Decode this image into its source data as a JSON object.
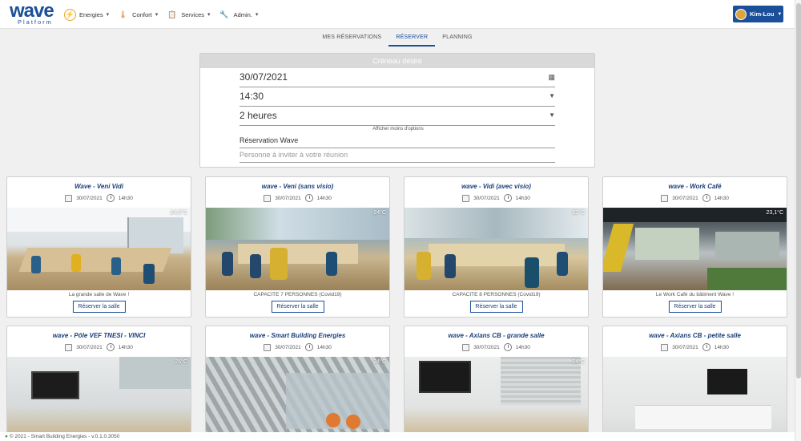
{
  "brand": {
    "name": "wave",
    "sub": "Platform"
  },
  "nav": [
    {
      "label": "Energies",
      "icon": "lightning-icon",
      "color": "#f0a020"
    },
    {
      "label": "Confort",
      "icon": "thermometer-icon",
      "color": "#e07a30"
    },
    {
      "label": "Services",
      "icon": "clipboard-icon",
      "color": "#5a7fbf"
    },
    {
      "label": "Admin.",
      "icon": "tools-icon",
      "color": "#c08050"
    }
  ],
  "user": {
    "name": "Kim-Lou"
  },
  "tabs": [
    {
      "label": "MES RÉSERVATIONS",
      "active": false
    },
    {
      "label": "RÉSERVER",
      "active": true
    },
    {
      "label": "PLANNING",
      "active": false
    }
  ],
  "form": {
    "title": "Créneau désiré",
    "date": "30/07/2021",
    "time": "14:30",
    "duration": "2 heures",
    "options_link": "Afficher moins d'options",
    "subject": "Réservation Wave",
    "invite_placeholder": "Personne à inviter à votre réunion"
  },
  "cards": [
    {
      "title": "Wave - Veni Vidi",
      "date": "30/07/2021",
      "time": "14h30",
      "temp": "24,5°C",
      "desc": "La grande salle de Wave !",
      "button": "Réserver la salle"
    },
    {
      "title": "wave - Veni (sans visio)",
      "date": "30/07/2021",
      "time": "14h30",
      "temp": "24°C",
      "desc": "CAPACITE 7 PERSONNES (Covid19)",
      "button": "Réserver la salle"
    },
    {
      "title": "wave - Vidi (avec visio)",
      "date": "30/07/2021",
      "time": "14h30",
      "temp": "23°C",
      "desc": "CAPACITE 8 PERSONNES (Covid19)",
      "button": "Réserver la salle"
    },
    {
      "title": "wave - Work Café",
      "date": "30/07/2021",
      "time": "14h30",
      "temp": "23,1°C",
      "desc": "Le Work Café du bâtiment Wave !",
      "button": "Réserver la salle"
    },
    {
      "title": "wave - Pôle VEF TNESI - VINCI",
      "date": "30/07/2021",
      "time": "14h30",
      "temp": "26°C",
      "desc": "",
      "button": ""
    },
    {
      "title": "wave - Smart Building Energies",
      "date": "30/07/2021",
      "time": "14h30",
      "temp": "24°C",
      "desc": "",
      "button": ""
    },
    {
      "title": "wave - Axians CB - grande salle",
      "date": "30/07/2021",
      "time": "14h30",
      "temp": "24°C",
      "desc": "",
      "button": ""
    },
    {
      "title": "wave - Axians CB - petite salle",
      "date": "30/07/2021",
      "time": "14h30",
      "temp": "",
      "desc": "",
      "button": ""
    }
  ],
  "footer": {
    "text": "© 2021 - Smart Building Energies - v.0.1.0.3050"
  },
  "colors": {
    "primary": "#1b4f9a"
  }
}
